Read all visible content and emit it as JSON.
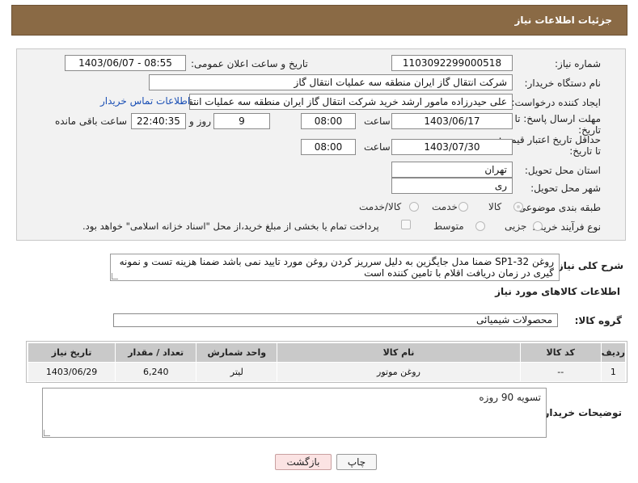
{
  "header": {
    "title": "جزئیات اطلاعات نیاز"
  },
  "form": {
    "need_number_label": "شماره نیاز:",
    "need_number": "1103092299000518",
    "announce_label": "تاریخ و ساعت اعلان عمومی:",
    "announce_value": "1403/06/07 - 08:55",
    "buyer_org_label": "نام دستگاه خریدار:",
    "buyer_org": "شرکت انتقال گاز ایران منطقه سه عملیات انتقال گاز",
    "requester_label": "ایجاد کننده درخواست:",
    "requester": "علی حیدرزاده مامور ارشد خرید شرکت انتقال گاز ایران منطقه سه عملیات انتقال",
    "buyer_contact_link": "اطلاعات تماس خریدار",
    "deadline_label": "مهلت ارسال پاسخ: تا تاریخ:",
    "deadline_date": "1403/06/17",
    "time_label": "ساعت",
    "deadline_time": "08:00",
    "days_value": "9",
    "days_label": "روز و",
    "remaining_time": "22:40:35",
    "remaining_label": "ساعت باقی مانده",
    "validity_label": "حداقل تاریخ اعتبار قیمت: تا تاریخ:",
    "validity_date": "1403/07/30",
    "validity_time": "08:00",
    "province_label": "استان محل تحویل:",
    "province": "تهران",
    "city_label": "شهر محل تحویل:",
    "city": "ری",
    "category_label": "طبقه بندی موضوعی:",
    "category_options": [
      "کالا",
      "خدمت",
      "کالا/خدمت"
    ],
    "process_label": "نوع فرآیند خرید :",
    "process_options": [
      "جزیی",
      "متوسط"
    ],
    "payment_note": "پرداخت تمام یا بخشی از مبلغ خرید،از محل \"اسناد خزانه اسلامی\" خواهد بود."
  },
  "description": {
    "label": "شرح کلی نیاز:",
    "text": "روغن SP1-32 ضمنا مدل جایگزین به دلیل سرریز کردن روغن مورد تایید نمی باشد ضمنا هزینه تست و نمونه گیری در زمان دریافت اقلام با تامین کننده است"
  },
  "items_section": {
    "title": "اطلاعات کالاهای مورد نیاز",
    "group_label": "گروه کالا:",
    "group_value": "محصولات شیمیائی"
  },
  "table": {
    "headers": [
      "ردیف",
      "کد کالا",
      "نام کالا",
      "واحد شمارش",
      "تعداد / مقدار",
      "تاریخ نیاز"
    ],
    "rows": [
      [
        "1",
        "--",
        "روغن موتور",
        "لیتر",
        "6,240",
        "1403/06/29"
      ]
    ]
  },
  "buyer_notes": {
    "label": "توضیحات خریدار:",
    "text": "تسویه 90 روزه"
  },
  "buttons": {
    "print": "چاپ",
    "back": "بازگشت"
  }
}
